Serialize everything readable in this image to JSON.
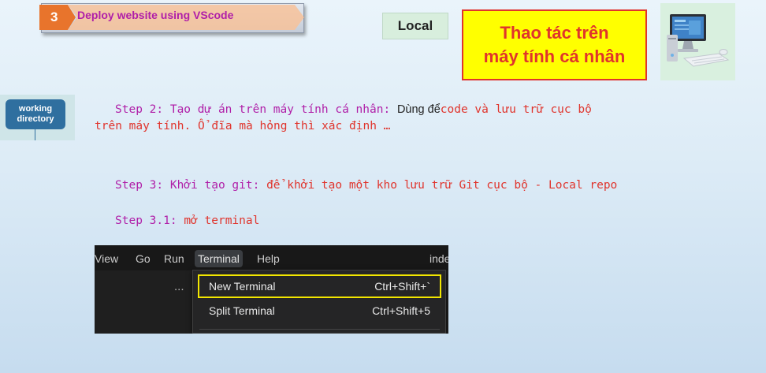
{
  "header": {
    "step_number": "3",
    "step_title": "Deploy website using VScode",
    "local_label": "Local",
    "personal_line1": "Thao tác trên",
    "personal_line2": "máy tính cá nhân"
  },
  "working_dir": {
    "line1": "working",
    "line2": "directory"
  },
  "steps": {
    "step2_label": "Step 2: Tạo dự án trên máy tính cá nhân:",
    "step2_mid": "Dùng để",
    "step2_rest": "code và lưu trữ cục bộ",
    "step2_line2": "trên máy tính. Ổ đĩa mà hỏng thì xác định …",
    "step3_label": "Step 3: Khởi tạo git:",
    "step3_rest": "để khởi tạo một kho lưu trữ Git cục bộ - Local repo",
    "step31_label": "Step 3.1:",
    "step31_rest": "mở terminal"
  },
  "vscode": {
    "menu": [
      "View",
      "Go",
      "Run",
      "Terminal",
      "Help"
    ],
    "active_menu": "Terminal",
    "right_text": "inde",
    "dots": "...",
    "dropdown": [
      {
        "label": "New Terminal",
        "shortcut": "Ctrl+Shift+`",
        "highlighted": true
      },
      {
        "label": "Split Terminal",
        "shortcut": "Ctrl+Shift+5",
        "highlighted": false
      }
    ]
  },
  "colors": {
    "accent_magenta": "#b01fa8",
    "accent_red": "#e0342c",
    "highlight_yellow": "#ffff00",
    "step_orange": "#e8742c"
  }
}
